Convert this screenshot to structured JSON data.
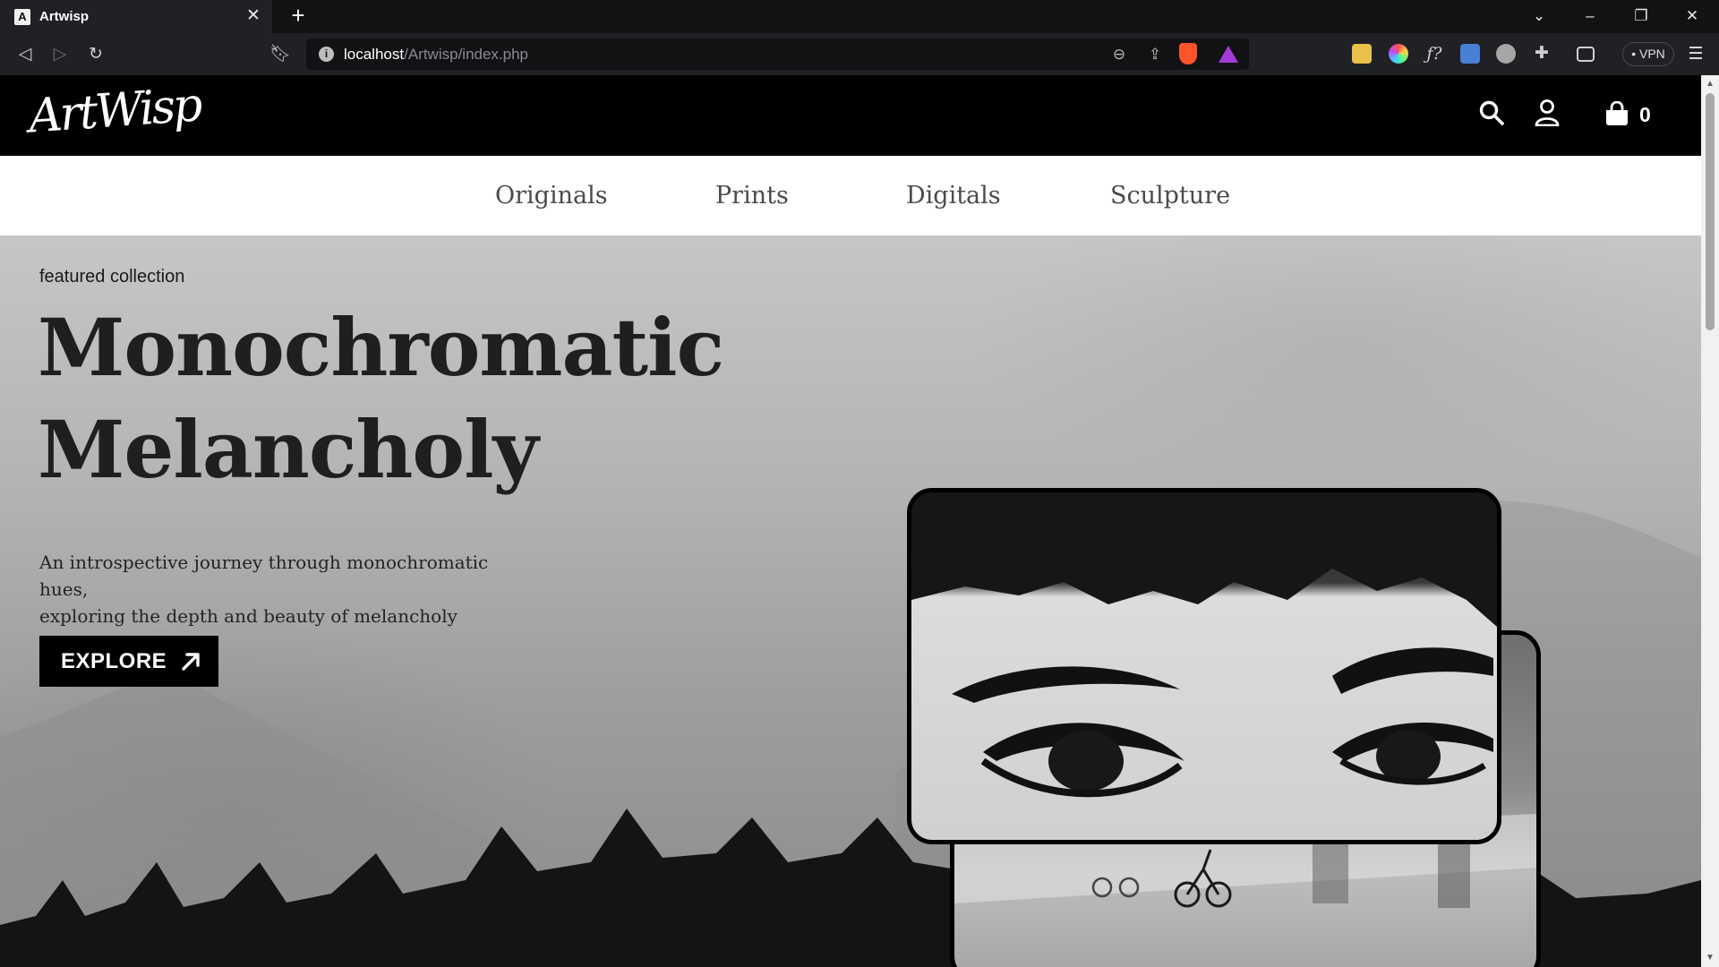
{
  "browser": {
    "tab_title": "Artwisp",
    "tab_favicon": "A",
    "url_host": "localhost",
    "url_path": "/Artwisp/index.php",
    "vpn_label": "VPN"
  },
  "header": {
    "logo_text": "ArtWisp",
    "cart_count": "0"
  },
  "nav": {
    "items": [
      {
        "label": "Originals"
      },
      {
        "label": "Prints"
      },
      {
        "label": "Digitals"
      },
      {
        "label": "Sculpture"
      }
    ]
  },
  "hero": {
    "kicker": "featured collection",
    "title_line1": "Monochromatic",
    "title_line2": "Melancholy",
    "subtitle_line1": "An introspective journey through monochromatic hues,",
    "subtitle_line2": "exploring the depth and beauty of melancholy",
    "cta_label": "EXPLORE"
  },
  "colors": {
    "header_bg": "#000000",
    "nav_text": "#4b4b4b",
    "hero_text": "#1f1f1f",
    "button_bg": "#000000",
    "brave_orange": "#fb542b",
    "rewards_purple": "#a33bd8"
  },
  "icons": {
    "header": [
      "search-icon",
      "user-icon",
      "shopping-bag-icon"
    ],
    "cta": "arrow-up-right-icon"
  }
}
